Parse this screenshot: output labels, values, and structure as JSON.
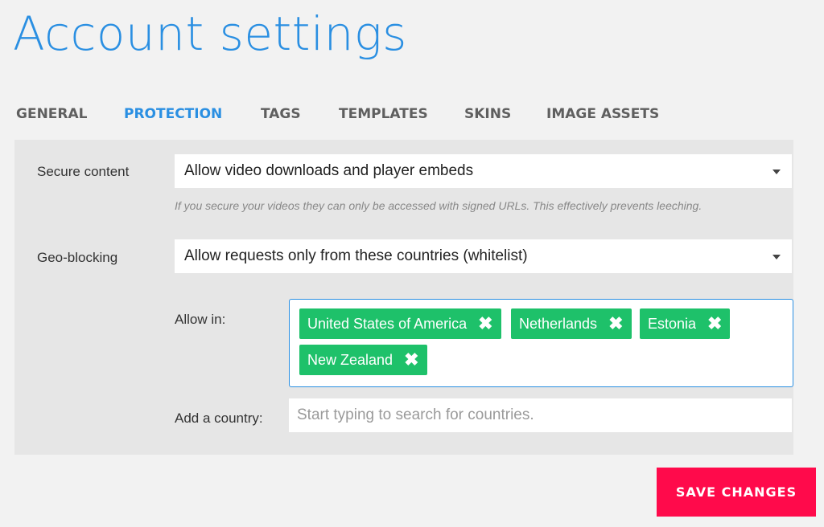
{
  "page": {
    "title": "Account settings"
  },
  "tabs": [
    {
      "label": "GENERAL",
      "active": false
    },
    {
      "label": "PROTECTION",
      "active": true
    },
    {
      "label": "TAGS",
      "active": false
    },
    {
      "label": "TEMPLATES",
      "active": false
    },
    {
      "label": "SKINS",
      "active": false
    },
    {
      "label": "IMAGE ASSETS",
      "active": false
    }
  ],
  "secure_content": {
    "label": "Secure content",
    "value": "Allow video downloads and player embeds",
    "help": "If you secure your videos they can only be accessed with signed URLs. This effectively prevents leeching."
  },
  "geo_blocking": {
    "label": "Geo-blocking",
    "value": "Allow requests only from these countries (whitelist)"
  },
  "allow_in": {
    "label": "Allow in:",
    "countries": [
      "United States of America",
      "Netherlands",
      "Estonia",
      "New Zealand"
    ]
  },
  "add_country": {
    "label": "Add a country:",
    "placeholder": "Start typing to search for countries.",
    "value": ""
  },
  "save_button": {
    "label": "SAVE CHANGES"
  },
  "colors": {
    "accent": "#2a8fe2",
    "tag_green": "#1ec16a",
    "save_red": "#ff0a4b",
    "background": "#f2f2f2",
    "panel": "#e6e6e6"
  }
}
